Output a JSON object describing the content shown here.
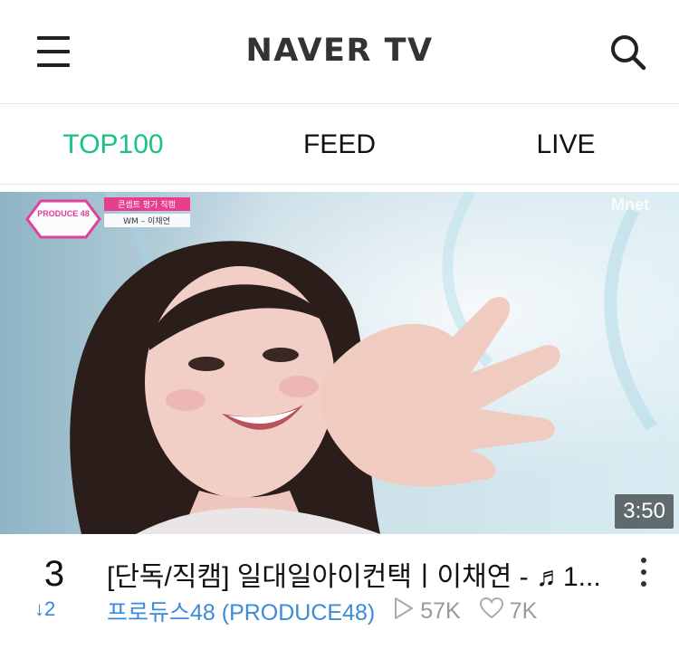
{
  "header": {
    "logo": "NAVER TV"
  },
  "tabs": [
    {
      "label": "TOP100",
      "active": true
    },
    {
      "label": "FEED",
      "active": false
    },
    {
      "label": "LIVE",
      "active": false
    }
  ],
  "video": {
    "duration": "3:50",
    "overlay": {
      "show_logo": "PRODUCE 48",
      "caption_line1": "콘셉트 평가 직캠",
      "caption_line2": "WM – 이채연",
      "broadcaster": "Mnet"
    },
    "rank": "3",
    "rank_change": "2",
    "title": "[단독/직캠] 일대일아이컨택ㅣ이채연 - ♬1...",
    "channel": "프로듀스48 (PRODUCE48)",
    "plays": "57K",
    "likes": "7K"
  },
  "colors": {
    "accent": "#19c37d",
    "link": "#3a8bd9",
    "rank_up_down": "#2f86de"
  },
  "icons": {
    "menu": "menu-icon",
    "search": "search-icon",
    "play": "play-icon",
    "heart": "heart-icon",
    "more": "more-vertical-icon",
    "down_arrow": "arrow-down-icon"
  }
}
